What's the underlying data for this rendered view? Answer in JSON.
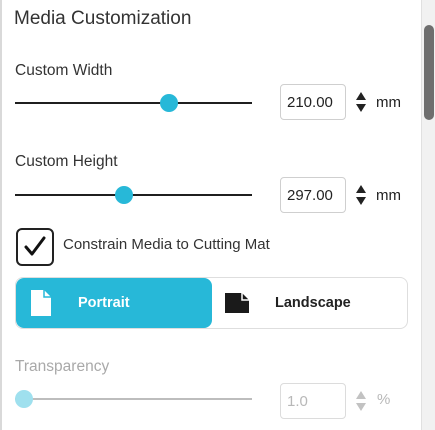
{
  "panel": {
    "title": "Media Customization"
  },
  "width": {
    "label": "Custom Width",
    "value": "210.00",
    "unit": "mm",
    "slider_fraction": 0.65
  },
  "height": {
    "label": "Custom Height",
    "value": "297.00",
    "unit": "mm",
    "slider_fraction": 0.46
  },
  "constrain": {
    "label": "Constrain Media to Cutting Mat",
    "checked": true
  },
  "orientation": {
    "options": [
      {
        "label": "Portrait",
        "icon": "portrait-page-icon",
        "selected": true
      },
      {
        "label": "Landscape",
        "icon": "landscape-page-icon",
        "selected": false
      }
    ]
  },
  "transparency": {
    "label": "Transparency",
    "value": "1.0",
    "unit": "%",
    "slider_fraction": 0.04,
    "disabled": true
  },
  "colors": {
    "accent": "#27b8d8",
    "accent_disabled": "#9fe0ee"
  }
}
